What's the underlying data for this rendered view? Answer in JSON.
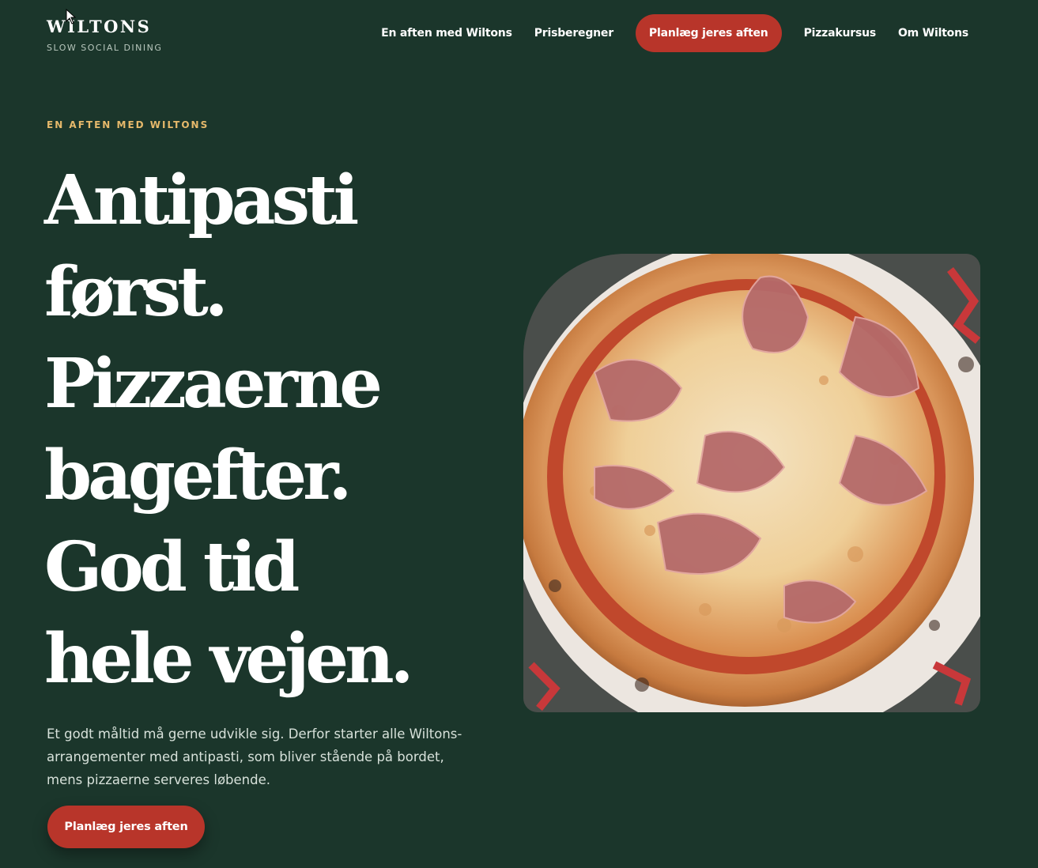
{
  "brand": {
    "name": "WILTONS",
    "tagline": "SLOW SOCIAL DINING"
  },
  "nav": {
    "items": [
      {
        "label": "En aften med Wiltons"
      },
      {
        "label": "Prisberegner"
      },
      {
        "label": "Planlæg jeres aften"
      },
      {
        "label": "Pizzakursus"
      },
      {
        "label": "Om Wiltons"
      }
    ]
  },
  "hero": {
    "eyebrow": "EN AFTEN MED WILTONS",
    "headline_lines": [
      "Antipasti",
      "først.",
      "Pizzaerne",
      "bagefter.",
      "God tid",
      "hele vejen."
    ],
    "intro": "Et godt måltid må gerne udvikle sig. Derfor starter alle Wiltons-arrangementer med antipasti, som bliver stående på bordet, mens pizzaerne serveres løbende.",
    "cta_label": "Planlæg jeres aften"
  },
  "image": {
    "subject": "pizza-with-ham"
  },
  "colors": {
    "background": "#1b362b",
    "accent": "#b8352a",
    "eyebrow": "#e6b96b"
  }
}
